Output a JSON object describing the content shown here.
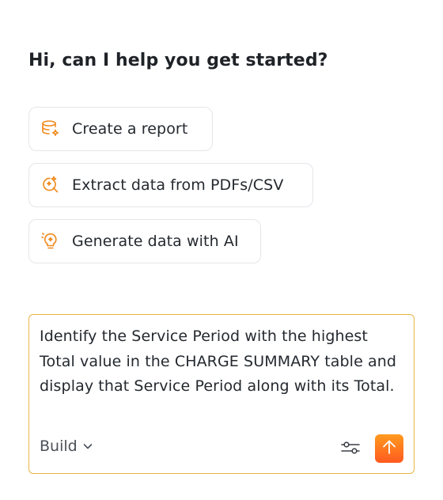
{
  "greeting": "Hi, can I help you get started?",
  "suggestions": [
    {
      "label": "Create a report",
      "icon": "database-sparkle-icon"
    },
    {
      "label": "Extract data from PDFs/CSV",
      "icon": "search-sparkle-icon"
    },
    {
      "label": "Generate data with AI",
      "icon": "lightbulb-sparkle-icon"
    }
  ],
  "composer": {
    "prompt": "Identify the Service Period with the highest Total value in the CHARGE SUMMARY table and display that Service Period along with its Total.",
    "mode": "Build",
    "settings_icon": "sliders-icon",
    "send_icon": "arrow-up-icon"
  },
  "colors": {
    "accent": "#f08a1c",
    "composer_border": "#e8b548",
    "send_gradient_top": "#ff9a1f",
    "send_gradient_bottom": "#ff5a1f"
  }
}
